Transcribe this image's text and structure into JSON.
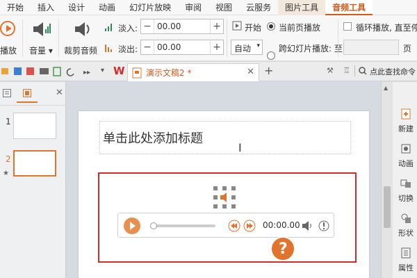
{
  "menu": {
    "tabs": [
      "开始",
      "插入",
      "设计",
      "动画",
      "幻灯片放映",
      "审阅",
      "视图",
      "云服务",
      "图片工具",
      "音频工具"
    ]
  },
  "ribbon": {
    "play_label": "播放",
    "volume_label": "音量",
    "trim_label": "裁剪音频",
    "fade_in_label": "淡入:",
    "fade_in_value": "00.00",
    "fade_out_label": "淡出:",
    "fade_out_value": "00.00",
    "start_label": "开始",
    "start_value": "自动",
    "current_page_label": "当前页播放",
    "cross_slide_label": "跨幻灯片播放: 至",
    "loop_label": "循环播放, 直至停",
    "page_label": "页"
  },
  "tabs_row": {
    "wps_logo": "W",
    "doc_title": "演示文稿2 *",
    "search_label": "点此查找命令"
  },
  "left_panel": {
    "slide_numbers": [
      "1",
      "2"
    ]
  },
  "slide": {
    "title_placeholder": "单击此处添加标题",
    "player_time": "00:00.00"
  },
  "right_panel": {
    "buttons": [
      "新建",
      "动画",
      "切换",
      "形状",
      "属性"
    ]
  },
  "watermark": {
    "text": "?"
  }
}
